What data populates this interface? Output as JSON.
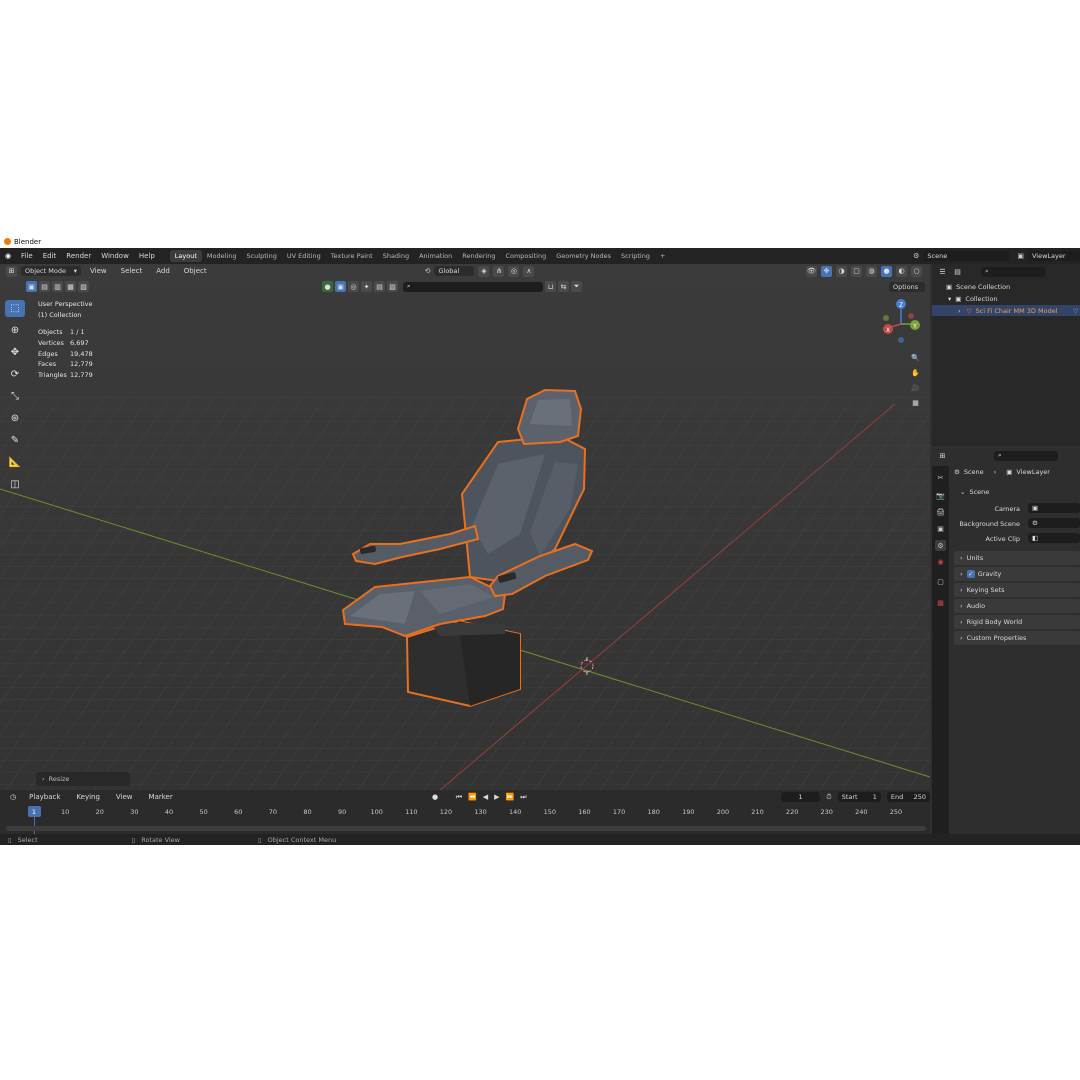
{
  "window": {
    "title": "Blender"
  },
  "menu": [
    "File",
    "Edit",
    "Render",
    "Window",
    "Help"
  ],
  "workspaces": [
    "Layout",
    "Modeling",
    "Sculpting",
    "UV Editing",
    "Texture Paint",
    "Shading",
    "Animation",
    "Rendering",
    "Compositing",
    "Geometry Nodes",
    "Scripting"
  ],
  "scene_field": "Scene",
  "viewlayer_field": "ViewLayer",
  "viewport": {
    "mode": "Object Mode",
    "header_menus": [
      "View",
      "Select",
      "Add",
      "Object"
    ],
    "transform_orientation": "Global",
    "options_label": "Options",
    "perspective_label": "User Perspective",
    "collection_label": "(1) Collection",
    "resize_label": "Resize",
    "gizmo_axes": [
      "X",
      "Y",
      "Z"
    ],
    "object_name": "Sci Fi Chair MM 3D Model"
  },
  "stats": [
    {
      "key": "Objects",
      "value": "1 / 1"
    },
    {
      "key": "Vertices",
      "value": "6,697"
    },
    {
      "key": "Edges",
      "value": "19,478"
    },
    {
      "key": "Faces",
      "value": "12,779"
    },
    {
      "key": "Triangles",
      "value": "12,779"
    }
  ],
  "timeline": {
    "menus": [
      "Playback",
      "Keying",
      "View",
      "Marker"
    ],
    "current_frame": "1",
    "start_label": "Start",
    "start_value": "1",
    "end_label": "End",
    "end_value": "250",
    "ticks": [
      "1",
      "10",
      "20",
      "30",
      "40",
      "50",
      "60",
      "70",
      "80",
      "90",
      "100",
      "110",
      "120",
      "130",
      "140",
      "150",
      "160",
      "170",
      "180",
      "190",
      "200",
      "210",
      "220",
      "230",
      "240",
      "250"
    ]
  },
  "statusbar": {
    "select": "Select",
    "rotate": "Rotate View",
    "context": "Object Context Menu"
  },
  "outliner": {
    "scene_collection": "Scene Collection",
    "collection": "Collection",
    "object": "Sci Fi Chair MM 3D Model"
  },
  "properties": {
    "breadcrumb_scene": "Scene",
    "breadcrumb_viewlayer": "ViewLayer",
    "section_scene": "Scene",
    "camera_label": "Camera",
    "background_scene_label": "Background Scene",
    "active_clip_label": "Active Clip",
    "sections": [
      "Units",
      "Gravity",
      "Keying Sets",
      "Audio",
      "Rigid Body World",
      "Custom Properties"
    ],
    "gravity_checked": true
  },
  "colors": {
    "selection_outline": "#e8701f",
    "x_axis": "#c04a4a",
    "y_axis": "#7aa23a",
    "accent": "#4772b3"
  }
}
